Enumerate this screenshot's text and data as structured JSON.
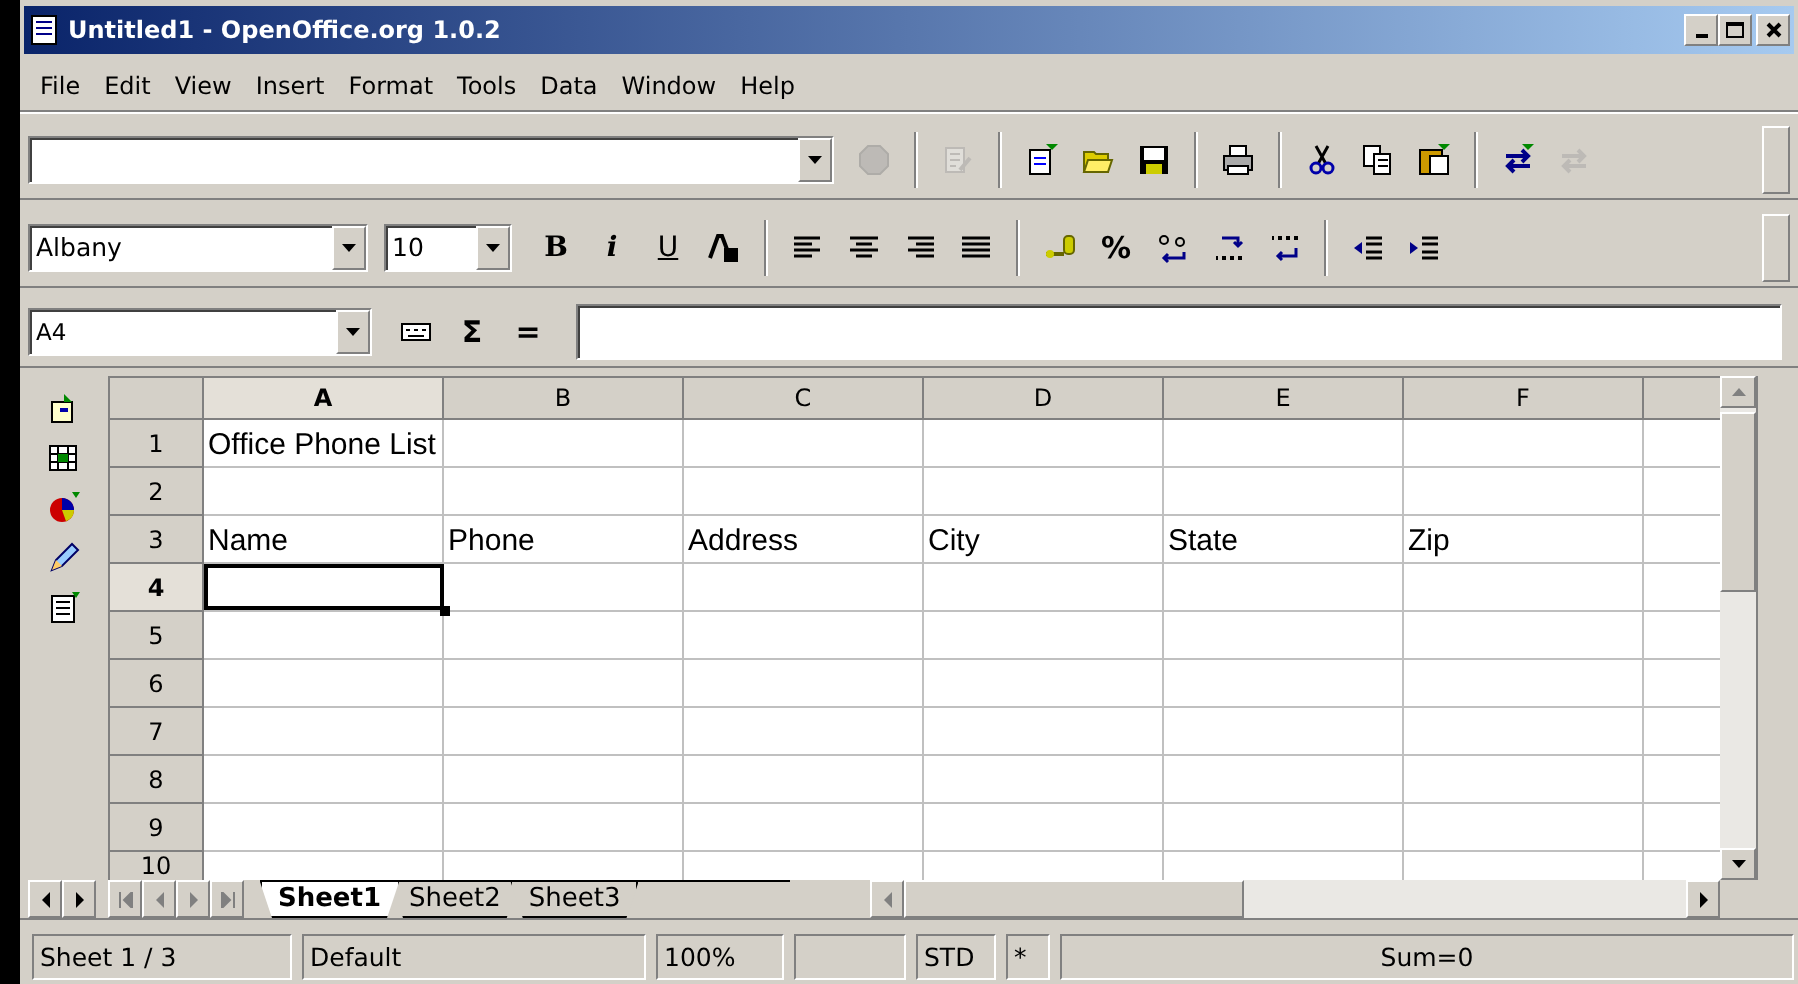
{
  "window": {
    "title": "Untitled1 - OpenOffice.org 1.0.2"
  },
  "menu": [
    "File",
    "Edit",
    "View",
    "Insert",
    "Format",
    "Tools",
    "Data",
    "Window",
    "Help"
  ],
  "function_bar": {
    "groups": [
      {
        "buttons": [
          {
            "kind": "stop",
            "disabled": true
          }
        ]
      },
      {
        "buttons": [
          {
            "kind": "edit-file",
            "disabled": true
          }
        ]
      },
      {
        "buttons": [
          {
            "kind": "new",
            "disabled": false
          },
          {
            "kind": "open",
            "disabled": false
          },
          {
            "kind": "save",
            "disabled": false
          }
        ]
      },
      {
        "buttons": [
          {
            "kind": "print",
            "disabled": false
          }
        ]
      },
      {
        "buttons": [
          {
            "kind": "cut",
            "disabled": false
          },
          {
            "kind": "copy",
            "disabled": false
          },
          {
            "kind": "paste",
            "disabled": false
          }
        ]
      },
      {
        "buttons": [
          {
            "kind": "undo",
            "disabled": false
          },
          {
            "kind": "redo",
            "disabled": true
          }
        ]
      }
    ]
  },
  "formatting_bar": {
    "font_name": "Albany",
    "font_size": "10",
    "buttons": [
      {
        "kind": "bold",
        "label": "B"
      },
      {
        "kind": "italic",
        "label": "i"
      },
      {
        "kind": "underline",
        "label": "U"
      },
      {
        "kind": "font-color"
      },
      {
        "kind": "separator"
      },
      {
        "kind": "align-left"
      },
      {
        "kind": "align-center"
      },
      {
        "kind": "align-right"
      },
      {
        "kind": "justify"
      },
      {
        "kind": "separator"
      },
      {
        "kind": "currency"
      },
      {
        "kind": "text",
        "label": "%"
      },
      {
        "kind": "standard-format"
      },
      {
        "kind": "add-decimal"
      },
      {
        "kind": "delete-decimal"
      },
      {
        "kind": "separator"
      },
      {
        "kind": "outdent"
      },
      {
        "kind": "indent"
      }
    ]
  },
  "formula_bar": {
    "name_box": "A4",
    "buttons": [
      {
        "kind": "function-wizard"
      },
      {
        "kind": "text",
        "label": "Σ"
      },
      {
        "kind": "text",
        "label": "="
      }
    ]
  },
  "side_toolbar": [
    {
      "kind": "insert"
    },
    {
      "kind": "insert-cells"
    },
    {
      "kind": "chart"
    },
    {
      "kind": "edit"
    },
    {
      "kind": "data"
    }
  ],
  "columns": [
    {
      "label": "A",
      "selected": true
    },
    {
      "label": "B",
      "selected": false
    },
    {
      "label": "C",
      "selected": false
    },
    {
      "label": "D",
      "selected": false
    },
    {
      "label": "E",
      "selected": false
    },
    {
      "label": "F",
      "selected": false
    }
  ],
  "rows": [
    {
      "label": "1",
      "selected": false,
      "cells": [
        "Office Phone List"
      ]
    },
    {
      "label": "2",
      "selected": false
    },
    {
      "label": "3",
      "selected": false,
      "cells": [
        "Name",
        "Phone",
        "Address",
        "City",
        "State",
        "Zip"
      ]
    },
    {
      "label": "4",
      "selected": true
    },
    {
      "label": "5",
      "selected": false
    },
    {
      "label": "6",
      "selected": false
    },
    {
      "label": "7",
      "selected": false
    },
    {
      "label": "8",
      "selected": false
    },
    {
      "label": "9",
      "selected": false
    },
    {
      "label": "10",
      "selected": false
    }
  ],
  "sheets": [
    {
      "label": "Sheet1",
      "selected": true
    },
    {
      "label": "Sheet2",
      "selected": false
    },
    {
      "label": "Sheet3",
      "selected": false
    }
  ],
  "status_bar": [
    {
      "kind": "text",
      "text": "Sheet 1 / 3"
    },
    {
      "kind": "text",
      "text": "Default"
    },
    {
      "kind": "text",
      "text": "100%"
    },
    {
      "kind": "empty"
    },
    {
      "kind": "text",
      "text": "STD"
    },
    {
      "kind": "text",
      "text": "*"
    },
    {
      "kind": "text",
      "text": "Sum=0"
    }
  ]
}
